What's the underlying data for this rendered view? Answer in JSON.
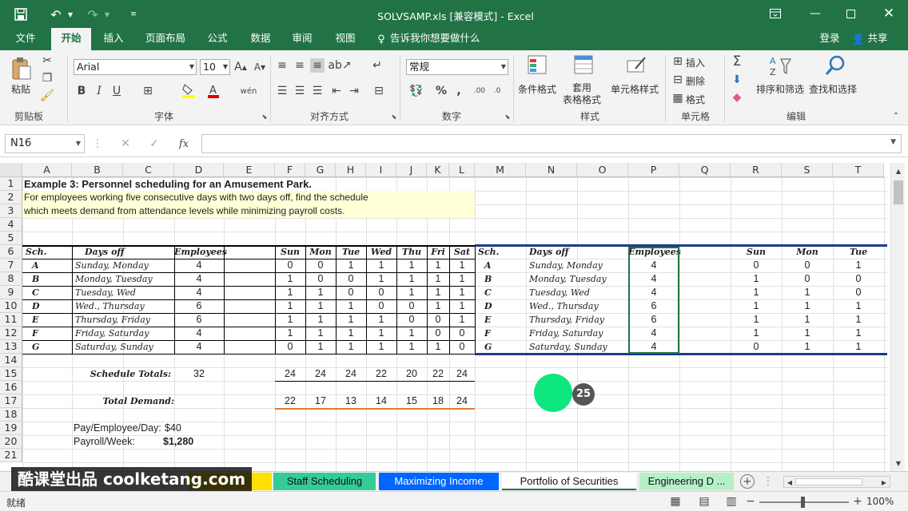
{
  "window": {
    "title": "SOLVSAMP.xls  [兼容模式] - Excel"
  },
  "tabs": [
    "文件",
    "开始",
    "插入",
    "页面布局",
    "公式",
    "数据",
    "审阅",
    "视图"
  ],
  "tell_me": "告诉我你想要做什么",
  "login": "登录",
  "share": "共享",
  "ribbon": {
    "paste": "粘贴",
    "font_name": "Arial",
    "font_size": "10",
    "number_format": "常规",
    "cond_format": "条件格式",
    "table_format": "套用\n表格格式",
    "cell_style": "单元格样式",
    "insert": "插入",
    "delete": "删除",
    "format": "格式",
    "sort_filter": "排序和筛选",
    "find_select": "查找和选择",
    "groups": [
      "剪贴板",
      "字体",
      "对齐方式",
      "数字",
      "样式",
      "单元格",
      "编辑"
    ]
  },
  "formula_bar": {
    "name_box": "N16",
    "fx": "fx",
    "content": ""
  },
  "columns": [
    "A",
    "B",
    "C",
    "D",
    "E",
    "F",
    "G",
    "H",
    "I",
    "J",
    "K",
    "L",
    "M",
    "N",
    "O",
    "P",
    "Q",
    "R",
    "S",
    "T"
  ],
  "rows": [
    "1",
    "2",
    "3",
    "4",
    "5",
    "6",
    "7",
    "8",
    "9",
    "10",
    "11",
    "12",
    "13",
    "14",
    "15",
    "16",
    "17",
    "18",
    "19",
    "20",
    "21"
  ],
  "sheet": {
    "title": "Example 3:  Personnel scheduling for an Amusement Park.",
    "desc1": "For employees working five consecutive days with two days off, find the schedule",
    "desc2": "which meets demand from attendance levels while minimizing payroll costs.",
    "hdr": {
      "sch": "Sch.",
      "days_off": "Days off",
      "employees": "Employees",
      "days": [
        "Sun",
        "Mon",
        "Tue",
        "Wed",
        "Thu",
        "Fri",
        "Sat"
      ],
      "right_days": [
        "Sun",
        "Mon",
        "Tue"
      ]
    },
    "schedules": [
      {
        "sch": "A",
        "off": "Sunday, Monday",
        "emp": "4",
        "d": [
          "0",
          "0",
          "1",
          "1",
          "1",
          "1",
          "1"
        ]
      },
      {
        "sch": "B",
        "off": "Monday, Tuesday",
        "emp": "4",
        "d": [
          "1",
          "0",
          "0",
          "1",
          "1",
          "1",
          "1"
        ]
      },
      {
        "sch": "C",
        "off": "Tuesday, Wed",
        "emp": "4",
        "d": [
          "1",
          "1",
          "0",
          "0",
          "1",
          "1",
          "1"
        ]
      },
      {
        "sch": "D",
        "off": "Wed., Thursday",
        "emp": "6",
        "d": [
          "1",
          "1",
          "1",
          "0",
          "0",
          "1",
          "1"
        ]
      },
      {
        "sch": "E",
        "off": "Thursday, Friday",
        "emp": "6",
        "d": [
          "1",
          "1",
          "1",
          "1",
          "0",
          "0",
          "1"
        ]
      },
      {
        "sch": "F",
        "off": "Friday, Saturday",
        "emp": "4",
        "d": [
          "1",
          "1",
          "1",
          "1",
          "1",
          "0",
          "0"
        ]
      },
      {
        "sch": "G",
        "off": "Saturday, Sunday",
        "emp": "4",
        "d": [
          "0",
          "1",
          "1",
          "1",
          "1",
          "1",
          "0"
        ]
      }
    ],
    "schedule_totals_label": "Schedule Totals:",
    "schedule_total": "32",
    "totals": [
      "24",
      "24",
      "24",
      "22",
      "20",
      "22",
      "24"
    ],
    "total_demand_label": "Total Demand:",
    "demand": [
      "22",
      "17",
      "13",
      "14",
      "15",
      "18",
      "24"
    ],
    "pay_label": "Pay/Employee/Day:",
    "pay": "$40",
    "payroll_label": "Payroll/Week:",
    "payroll": "$1,280"
  },
  "cursor_badge": "25",
  "sheet_tabs": [
    "Staff Scheduling",
    "Maximizing Income",
    "Portfolio of Securities",
    "Engineering D ..."
  ],
  "watermark": "酷课堂出品 coolketang.com",
  "status": {
    "ready": "就绪",
    "zoom": "100%"
  },
  "colors": {
    "excel_green": "#217346",
    "cursor": "#00e676"
  }
}
